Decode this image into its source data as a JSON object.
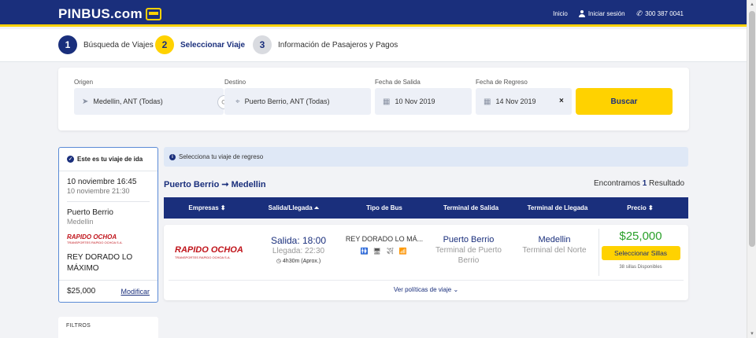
{
  "header": {
    "logo_text": "PINBUS.com",
    "nav": {
      "inicio": "Inicio",
      "login": "Iniciar sesión",
      "phone": "300 387 0041"
    },
    "colors": {
      "primary": "#1a2f7c",
      "accent": "#ffd200"
    }
  },
  "steps": [
    {
      "num": "1",
      "label": "Búsqueda de Viajes"
    },
    {
      "num": "2",
      "label": "Seleccionar Viaje"
    },
    {
      "num": "3",
      "label": "Información de Pasajeros y Pagos"
    }
  ],
  "search": {
    "origin_label": "Origen",
    "origin_value": "Medellin, ANT (Todas)",
    "dest_label": "Destino",
    "dest_value": "Puerto Berrio, ANT (Todas)",
    "out_label": "Fecha de Salida",
    "out_value": "10 Nov 2019",
    "ret_label": "Fecha de Regreso",
    "ret_value": "14 Nov 2019",
    "clear": "×",
    "button": "Buscar"
  },
  "trip": {
    "heading": "Este es tu viaje de ida",
    "date_dep": "10 noviembre 16:45",
    "date_arr": "10 noviembre 21:30",
    "city": "Puerto Berrio",
    "city_sub": "Medellin",
    "company_logo": "RAPIDO OCHOA",
    "company_logo_sub": "TRANSPORTES RAPIDO OCHOA S.A.",
    "bus_type": "REY DORADO LO MÁXIMO",
    "price": "$25,000",
    "modify": "Modificar"
  },
  "filters_label": "FILTROS",
  "results": {
    "notice": "Selecciona tu viaje de regreso",
    "route": "Puerto Berrio ➞ Medellin",
    "found_prefix": "Encontramos",
    "found_count": "1",
    "found_suffix": "Resultado",
    "columns": [
      "Empresas ⬍",
      "Salida/Llegada ⏶",
      "Tipo de Bus",
      "Terminal de Salida",
      "Terminal de Llegada",
      "Precio ⬍"
    ],
    "row": {
      "company": "RAPIDO OCHOA",
      "company_sub": "TRANSPORTES RAPIDO OCHOA S.A.",
      "departure": "Salida: 18:00",
      "arrival": "Llegada: 22:30",
      "duration": "4h30m (Aprox.)",
      "bus_type": "REY DORADO LO MÁ...",
      "amenities": "🚻 🖥 ✈ 📶",
      "dep_terminal_city": "Puerto Berrio",
      "dep_terminal": "Terminal de Puerto Berrio",
      "arr_terminal_city": "Medellin",
      "arr_terminal": "Terminal del Norte",
      "price": "$25,000",
      "select_button": "Seleccionar Sillas",
      "seats": "38 sillas Disponibles",
      "policies": "Ver políticas de viaje"
    }
  }
}
